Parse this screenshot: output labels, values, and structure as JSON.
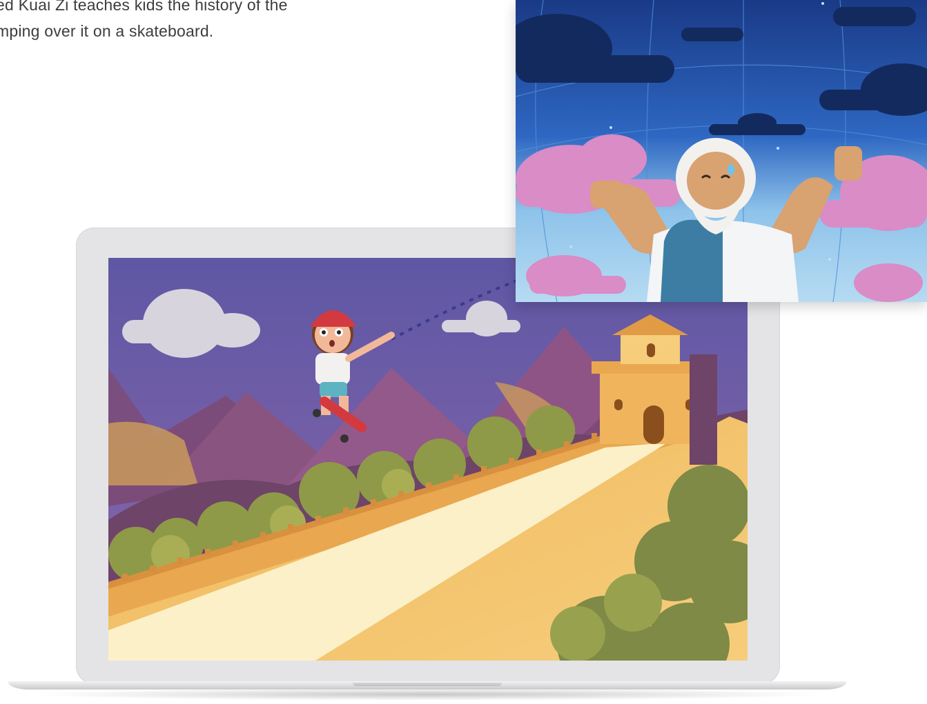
{
  "caption": {
    "line1": "ed Kuai Zi teaches kids the history of the",
    "line2": "mping over it on a skateboard."
  },
  "illustrations": {
    "laptop_scene": "skateboarder-over-great-wall",
    "card_scene": "strong-old-man-in-sky"
  },
  "colors": {
    "sky_purple": "#6a5aa3",
    "wall_yellow": "#f3c46a",
    "card_sky": "#1d3f8a",
    "cloud_pink": "#e08ac4"
  }
}
